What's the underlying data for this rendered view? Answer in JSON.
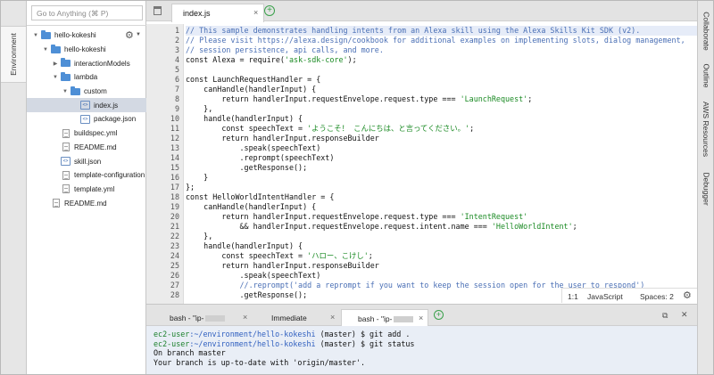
{
  "sidebar_left": {
    "tab": "Environment"
  },
  "tree": {
    "search_placeholder": "Go to Anything (⌘ P)",
    "items": [
      {
        "label": "hello-kokeshi",
        "kind": "folder",
        "depth": 0,
        "expanded": true
      },
      {
        "label": "hello-kokeshi",
        "kind": "folder",
        "depth": 1,
        "expanded": true
      },
      {
        "label": "interactionModels",
        "kind": "folder",
        "depth": 2,
        "expanded": false
      },
      {
        "label": "lambda",
        "kind": "folder",
        "depth": 2,
        "expanded": true
      },
      {
        "label": "custom",
        "kind": "folder",
        "depth": 3,
        "expanded": true
      },
      {
        "label": "index.js",
        "kind": "js",
        "depth": 4,
        "selected": true
      },
      {
        "label": "package.json",
        "kind": "js",
        "depth": 4
      },
      {
        "label": "buildspec.yml",
        "kind": "doc",
        "depth": 2
      },
      {
        "label": "README.md",
        "kind": "doc",
        "depth": 2
      },
      {
        "label": "skill.json",
        "kind": "js",
        "depth": 2
      },
      {
        "label": "template-configuration",
        "kind": "doc",
        "depth": 2
      },
      {
        "label": "template.yml",
        "kind": "doc",
        "depth": 2
      },
      {
        "label": "README.md",
        "kind": "doc",
        "depth": 1
      }
    ]
  },
  "editor": {
    "tab_label": "index.js",
    "close_glyph": "×",
    "add_glyph": "+",
    "lines": [
      "// This sample demonstrates handling intents from an Alexa skill using the Alexa Skills Kit SDK (v2).",
      "// Please visit https://alexa.design/cookbook for additional examples on implementing slots, dialog management,",
      "// session persistence, api calls, and more.",
      "const Alexa = require('ask-sdk-core');",
      "",
      "const LaunchRequestHandler = {",
      "    canHandle(handlerInput) {",
      "        return handlerInput.requestEnvelope.request.type === 'LaunchRequest';",
      "    },",
      "    handle(handlerInput) {",
      "        const speechText = 'ようこそ！ こんにちは、と言ってください。';",
      "        return handlerInput.responseBuilder",
      "            .speak(speechText)",
      "            .reprompt(speechText)",
      "            .getResponse();",
      "    }",
      "};",
      "const HelloWorldIntentHandler = {",
      "    canHandle(handlerInput) {",
      "        return handlerInput.requestEnvelope.request.type === 'IntentRequest'",
      "            && handlerInput.requestEnvelope.request.intent.name === 'HelloWorldIntent';",
      "    },",
      "    handle(handlerInput) {",
      "        const speechText = 'ハロー、こけし';",
      "        return handlerInput.responseBuilder",
      "            .speak(speechText)",
      "            //.reprompt('add a reprompt if you want to keep the session open for the user to respond')",
      "            .getResponse();"
    ],
    "status": {
      "position": "1:1",
      "language": "JavaScript",
      "spaces": "Spaces: 2"
    }
  },
  "sidebar_right": {
    "tabs": [
      "Collaborate",
      "Outline",
      "AWS Resources",
      "Debugger"
    ]
  },
  "terminal": {
    "tabs": [
      {
        "label": "bash - \"ip-"
      },
      {
        "label": "Immediate"
      },
      {
        "label": "bash - \"ip-"
      }
    ],
    "lines": [
      {
        "user": "ec2-user",
        "path": ":~/environment/hello-kokeshi",
        "rest": " (master) $ git add ."
      },
      {
        "user": "ec2-user",
        "path": ":~/environment/hello-kokeshi",
        "rest": " (master) $ git status"
      },
      {
        "text": "On branch master"
      },
      {
        "text": "Your branch is up-to-date with 'origin/master'."
      }
    ]
  },
  "colors": {
    "accent_green": "#3aa14b",
    "comment_blue": "#4a6fb5",
    "string_green": "#1a8a23",
    "selection": "#d3d9e3"
  }
}
